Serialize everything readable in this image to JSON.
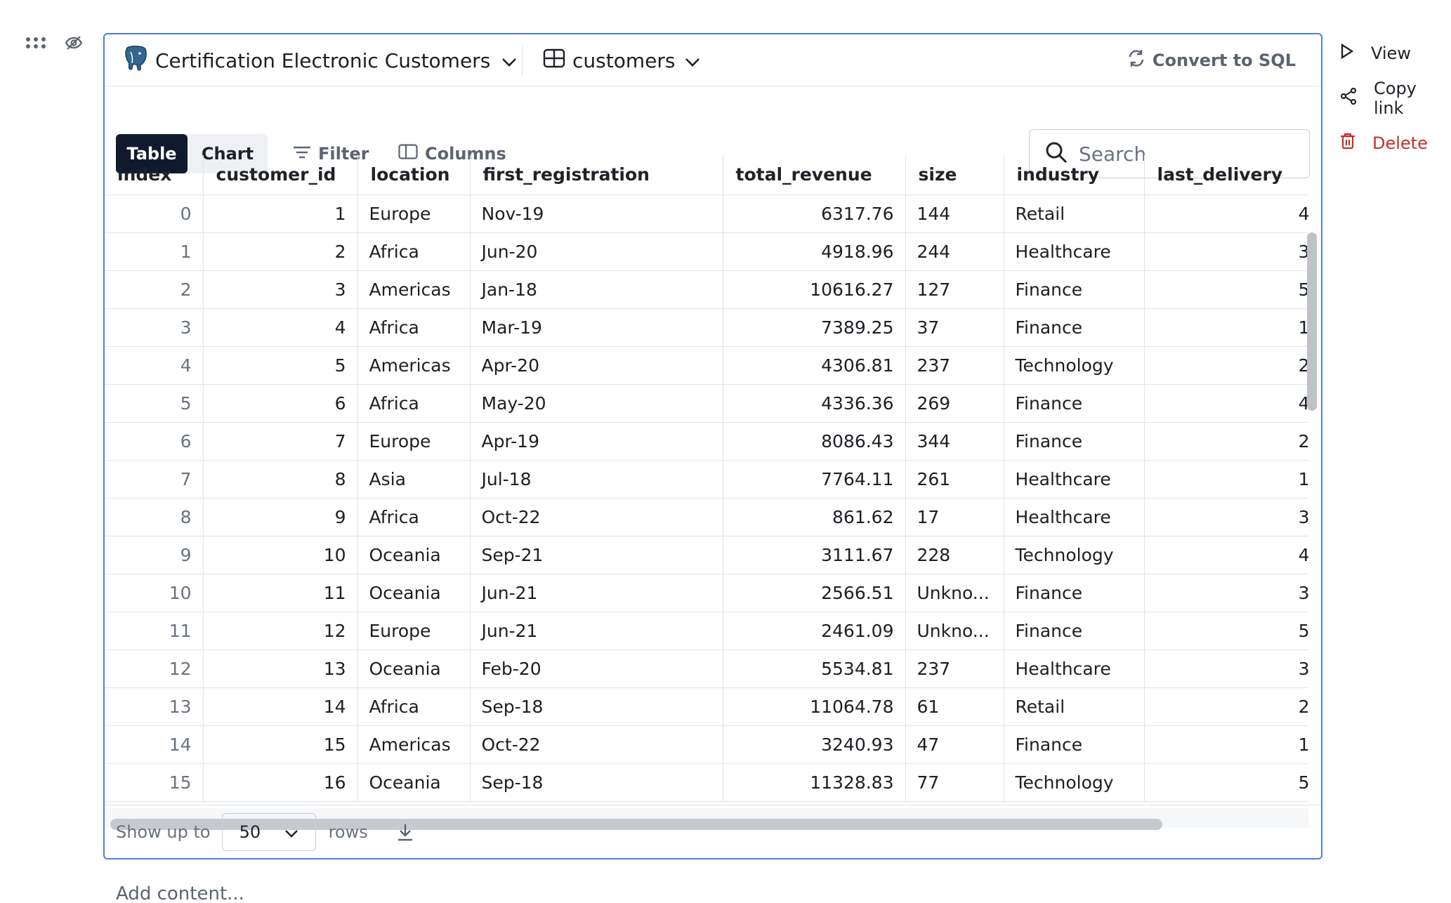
{
  "header": {
    "database_name": "Certification Electronic Customers",
    "table_name": "customers",
    "convert_label": "Convert to SQL"
  },
  "toolbar": {
    "table_tab": "Table",
    "chart_tab": "Chart",
    "filter_label": "Filter",
    "columns_label": "Columns",
    "search_placeholder": "Search"
  },
  "table": {
    "columns": [
      "index",
      "customer_id",
      "location",
      "first_registration",
      "total_revenue",
      "size",
      "industry",
      "last_delivery"
    ],
    "rows": [
      [
        "0",
        "1",
        "Europe",
        "Nov-19",
        "6317.76",
        "144",
        "Retail",
        "4"
      ],
      [
        "1",
        "2",
        "Africa",
        "Jun-20",
        "4918.96",
        "244",
        "Healthcare",
        "3"
      ],
      [
        "2",
        "3",
        "Americas",
        "Jan-18",
        "10616.27",
        "127",
        "Finance",
        "5"
      ],
      [
        "3",
        "4",
        "Africa",
        "Mar-19",
        "7389.25",
        "37",
        "Finance",
        "1"
      ],
      [
        "4",
        "5",
        "Americas",
        "Apr-20",
        "4306.81",
        "237",
        "Technology",
        "2"
      ],
      [
        "5",
        "6",
        "Africa",
        "May-20",
        "4336.36",
        "269",
        "Finance",
        "4"
      ],
      [
        "6",
        "7",
        "Europe",
        "Apr-19",
        "8086.43",
        "344",
        "Finance",
        "2"
      ],
      [
        "7",
        "8",
        "Asia",
        "Jul-18",
        "7764.11",
        "261",
        "Healthcare",
        "1"
      ],
      [
        "8",
        "9",
        "Africa",
        "Oct-22",
        "861.62",
        "17",
        "Healthcare",
        "3"
      ],
      [
        "9",
        "10",
        "Oceania",
        "Sep-21",
        "3111.67",
        "228",
        "Technology",
        "4"
      ],
      [
        "10",
        "11",
        "Oceania",
        "Jun-21",
        "2566.51",
        "Unkno...",
        "Finance",
        "3"
      ],
      [
        "11",
        "12",
        "Europe",
        "Jun-21",
        "2461.09",
        "Unkno...",
        "Finance",
        "5"
      ],
      [
        "12",
        "13",
        "Oceania",
        "Feb-20",
        "5534.81",
        "237",
        "Healthcare",
        "3"
      ],
      [
        "13",
        "14",
        "Africa",
        "Sep-18",
        "11064.78",
        "61",
        "Retail",
        "2"
      ],
      [
        "14",
        "15",
        "Americas",
        "Oct-22",
        "3240.93",
        "47",
        "Finance",
        "1"
      ],
      [
        "15",
        "16",
        "Oceania",
        "Sep-18",
        "11328.83",
        "77",
        "Technology",
        "5"
      ]
    ]
  },
  "footer": {
    "show_label": "Show up to",
    "rows_value": "50",
    "rows_label": "rows"
  },
  "side_actions": {
    "view": "View",
    "copy_link": "Copy link",
    "delete": "Delete"
  },
  "add_content": "Add content...",
  "colors": {
    "accent_border": "#4a7fe0",
    "active_tab": "#0f1b2d",
    "danger": "#c23127"
  }
}
